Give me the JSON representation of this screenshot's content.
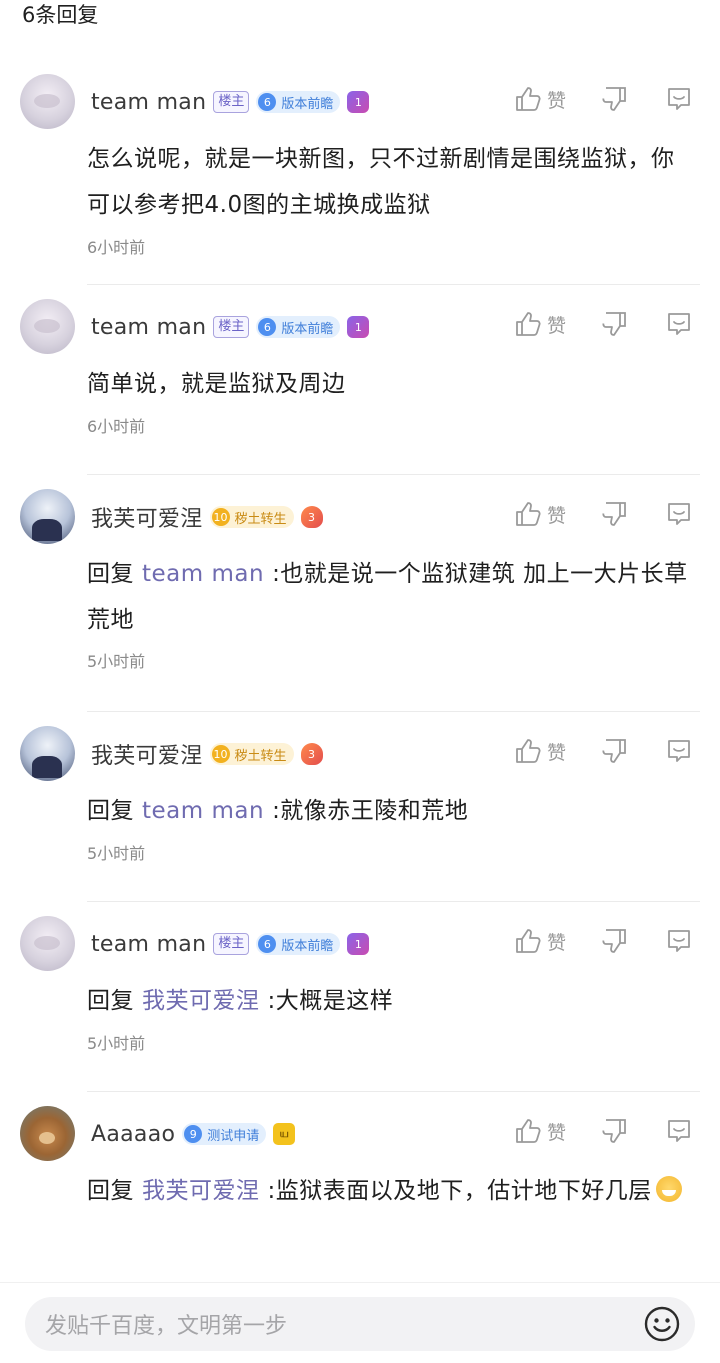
{
  "header": {
    "reply_count": "6条回复"
  },
  "actions": {
    "like_label": "赞"
  },
  "comments": [
    {
      "user": "team man",
      "host_badge": "楼主",
      "level": "6",
      "level_title": "版本前瞻",
      "medal": "1",
      "text": "怎么说呢，就是一块新图，只不过新剧情是围绕监狱，你可以参考把4.0图的主城换成监狱",
      "time": "6小时前"
    },
    {
      "user": "team man",
      "host_badge": "楼主",
      "level": "6",
      "level_title": "版本前瞻",
      "medal": "1",
      "text": "简单说，就是监狱及周边",
      "time": "6小时前"
    },
    {
      "user": "我芙可爱涅",
      "level": "10",
      "level_title": "秽土转生",
      "medal": "3",
      "reply_label": "回复",
      "reply_to": "team man",
      "text": ":也就是说一个监狱建筑 加上一大片长草荒地",
      "time": "5小时前"
    },
    {
      "user": "我芙可爱涅",
      "level": "10",
      "level_title": "秽土转生",
      "medal": "3",
      "reply_label": "回复",
      "reply_to": "team man",
      "text": ":就像赤王陵和荒地",
      "time": "5小时前"
    },
    {
      "user": "team man",
      "host_badge": "楼主",
      "level": "6",
      "level_title": "版本前瞻",
      "medal": "1",
      "reply_label": "回复",
      "reply_to": "我芙可爱涅",
      "text": ":大概是这样",
      "time": "5小时前"
    },
    {
      "user": "Aaaaao",
      "level": "9",
      "level_title": "测试申请",
      "medal": "ய",
      "reply_label": "回复",
      "reply_to": "我芙可爱涅",
      "text": ":监狱表面以及地下，估计地下好几层",
      "time": ""
    }
  ],
  "input": {
    "placeholder": "发贴千百度，文明第一步"
  }
}
